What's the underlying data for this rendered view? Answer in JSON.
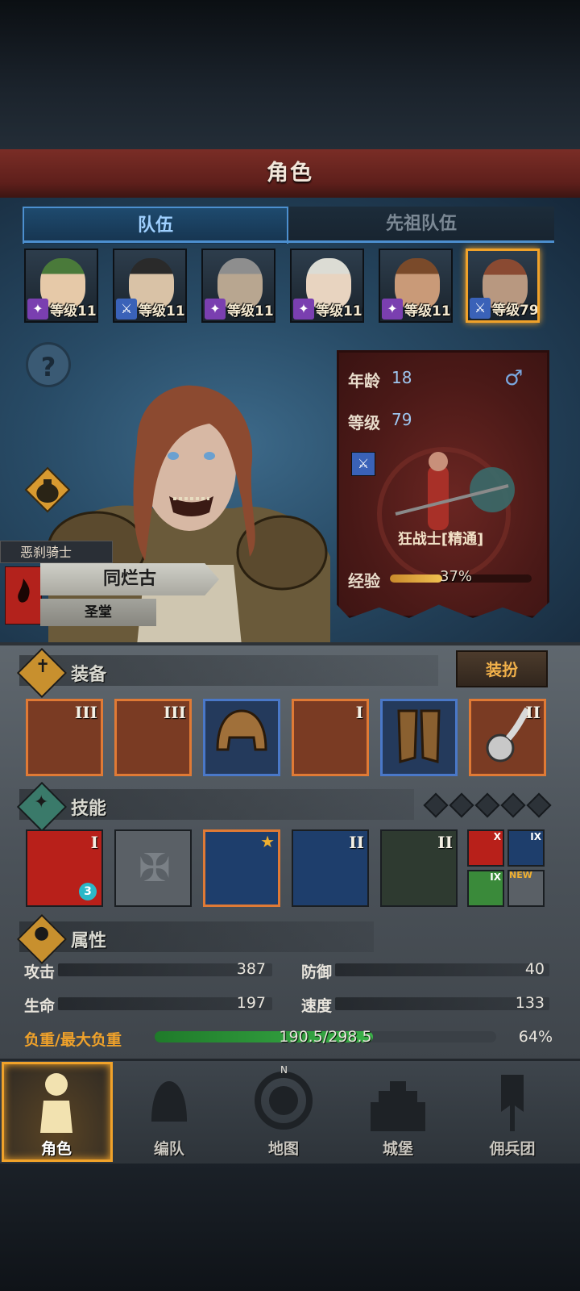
{
  "header": {
    "title": "角色"
  },
  "tabs": [
    {
      "label": "队伍"
    },
    {
      "label": "先祖队伍"
    }
  ],
  "party": [
    {
      "level_text": "等级111",
      "class_color": "#7a3fb0",
      "hair": "#4a7a3a",
      "skin": "#e6c9a8"
    },
    {
      "level_text": "等级118",
      "class_color": "#3a62b8",
      "hair": "#2a2a2a",
      "skin": "#d9c2a6"
    },
    {
      "level_text": "等级111",
      "class_color": "#7a3fb0",
      "hair": "#8e8e8e",
      "skin": "#b8a690"
    },
    {
      "level_text": "等级116",
      "class_color": "#7a3fb0",
      "hair": "#dcdcd4",
      "skin": "#e8d4c0"
    },
    {
      "level_text": "等级116",
      "class_color": "#7a3fb0",
      "hair": "#7a4a2a",
      "skin": "#c99a78"
    },
    {
      "level_text": "等级79",
      "class_color": "#3a62b8",
      "hair": "#8a4a32",
      "skin": "#b89880"
    }
  ],
  "character": {
    "class_tag": "恶刹骑士",
    "name": "同烂古",
    "faction": "圣堂",
    "age_label": "年龄",
    "age": "18",
    "level_label": "等级",
    "level": "79",
    "job": "狂战士[精通]",
    "exp_label": "经验",
    "exp_percent": 37,
    "exp_text": "37%",
    "gender_icon": "male-icon"
  },
  "equipment": {
    "title": "装备",
    "outfit_button": "装扮",
    "items": [
      {
        "tier": "III",
        "rarity": "orange"
      },
      {
        "tier": "III",
        "rarity": "orange"
      },
      {
        "tier": "",
        "rarity": "blue"
      },
      {
        "tier": "I",
        "rarity": "orange"
      },
      {
        "tier": "",
        "rarity": "blue"
      },
      {
        "tier": "II",
        "rarity": "orange"
      }
    ]
  },
  "skills": {
    "title": "技能",
    "items": [
      {
        "tier": "I",
        "badge": "3",
        "bg": "#b8201a"
      },
      {
        "tier": "",
        "badge": "",
        "bg": "#5a6066"
      },
      {
        "tier": "",
        "badge": "",
        "bg": "#1e3e6c"
      },
      {
        "tier": "II",
        "badge": "",
        "bg": "#1e3e6c"
      },
      {
        "tier": "II",
        "badge": "",
        "bg": "#2e3a30"
      }
    ],
    "passives": [
      {
        "tier": "X",
        "bg": "#b8201a"
      },
      {
        "tier": "IX",
        "bg": "#1e3e6c"
      },
      {
        "tier": "IX",
        "bg": "#3a8a3a"
      },
      {
        "tier": "NEW",
        "bg": "#5a6066"
      }
    ]
  },
  "attributes": {
    "title": "属性",
    "attack_label": "攻击",
    "attack": "387",
    "defense_label": "防御",
    "defense": "40",
    "hp_label": "生命",
    "hp": "197",
    "speed_label": "速度",
    "speed": "133",
    "load_label": "负重/最大负重",
    "load_text": "190.5/298.5",
    "load_percent": 64,
    "load_percent_text": "64%"
  },
  "nav": [
    {
      "label": "角色"
    },
    {
      "label": "编队"
    },
    {
      "label": "地图"
    },
    {
      "label": "城堡"
    },
    {
      "label": "佣兵团"
    }
  ],
  "colors": {
    "accent": "#f0a22a",
    "header": "#6a2622",
    "tab_active": "#4c8fcf",
    "load_bar": "#2f9a3a"
  }
}
